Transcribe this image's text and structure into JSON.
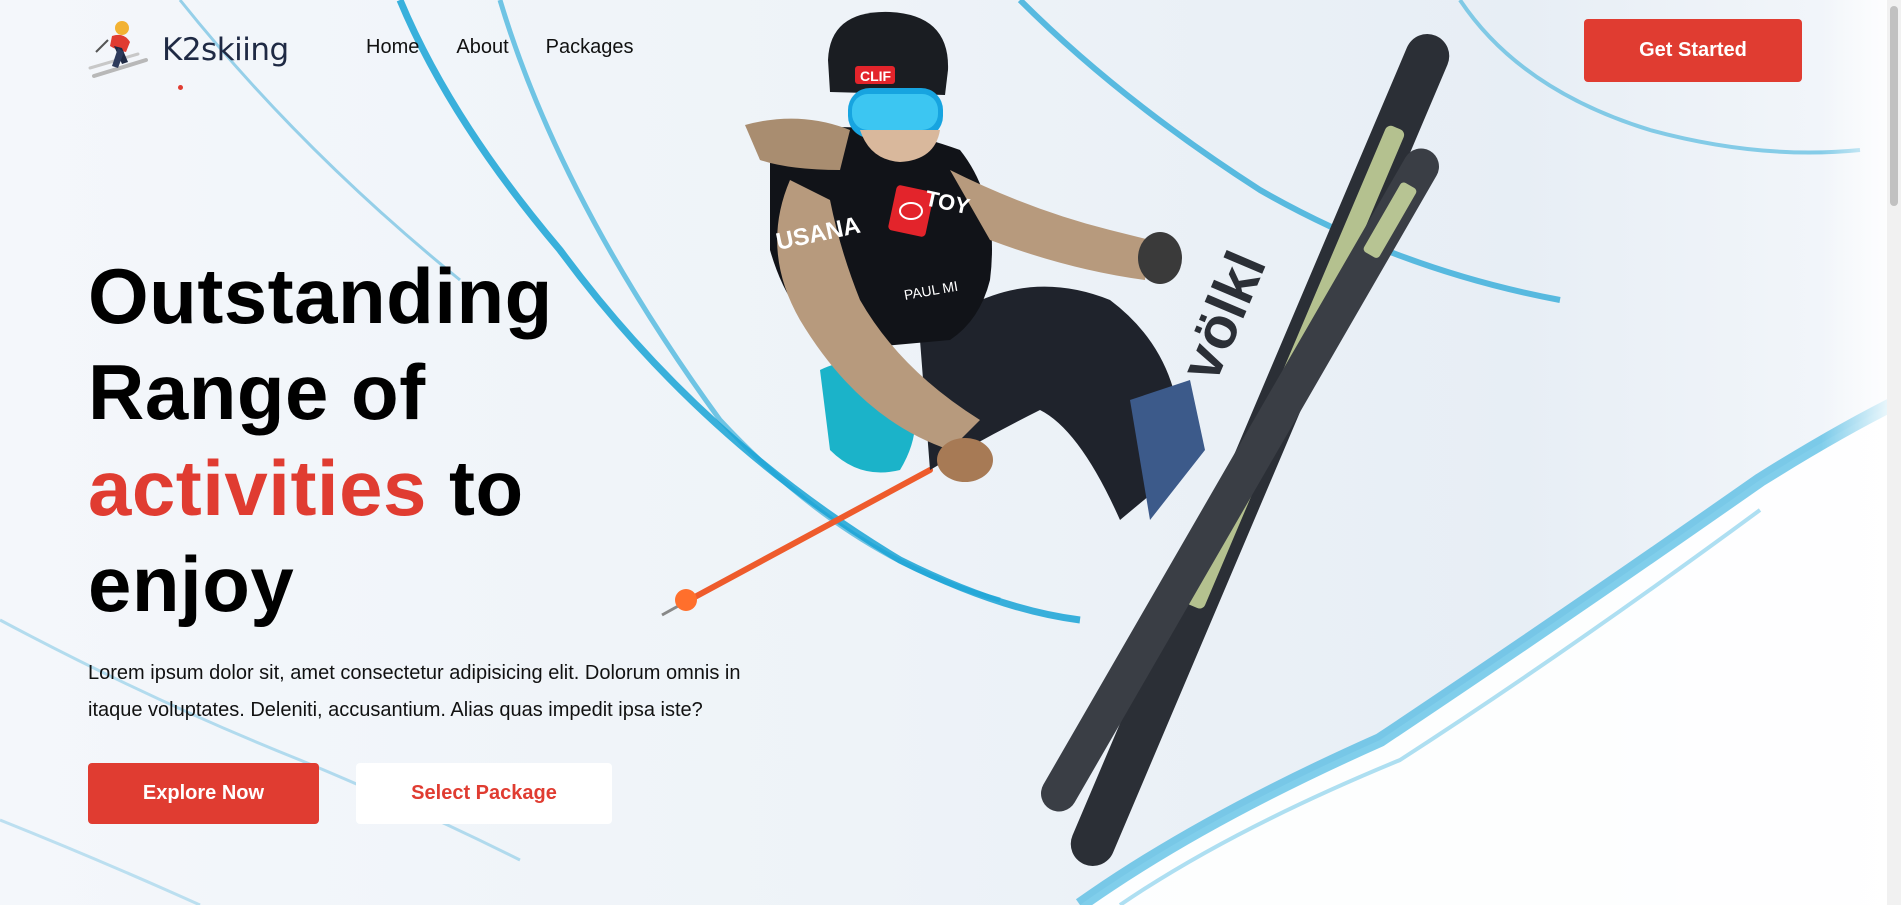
{
  "brand": {
    "name": "K2skiing",
    "logo_icon": "skier-logo-icon"
  },
  "nav": {
    "items": [
      {
        "label": "Home"
      },
      {
        "label": "About"
      },
      {
        "label": "Packages"
      }
    ]
  },
  "header": {
    "cta_label": "Get Started"
  },
  "hero": {
    "title_line1": "Outstanding",
    "title_line2": "Range of",
    "title_accent": "activities",
    "title_after_accent": " to",
    "title_line4": "enjoy",
    "description": "Lorem ipsum dolor sit, amet consectetur adipisicing elit. Dolorum omnis in itaque voluptates. Deleniti, accusantium. Alias quas impedit ipsa iste?",
    "primary_button": "Explore Now",
    "secondary_button": "Select Package",
    "image": "freestyle-skier-halfpipe-photo",
    "image_text": {
      "ski_brand": "völkl",
      "vest_brand": "USANA",
      "helmet_sponsor": "CLIF",
      "vest_tag": "TOY",
      "vest_name": "PAUL MI"
    }
  },
  "colors": {
    "accent": "#e03c31",
    "text": "#000000",
    "background": "#eef3f8"
  }
}
